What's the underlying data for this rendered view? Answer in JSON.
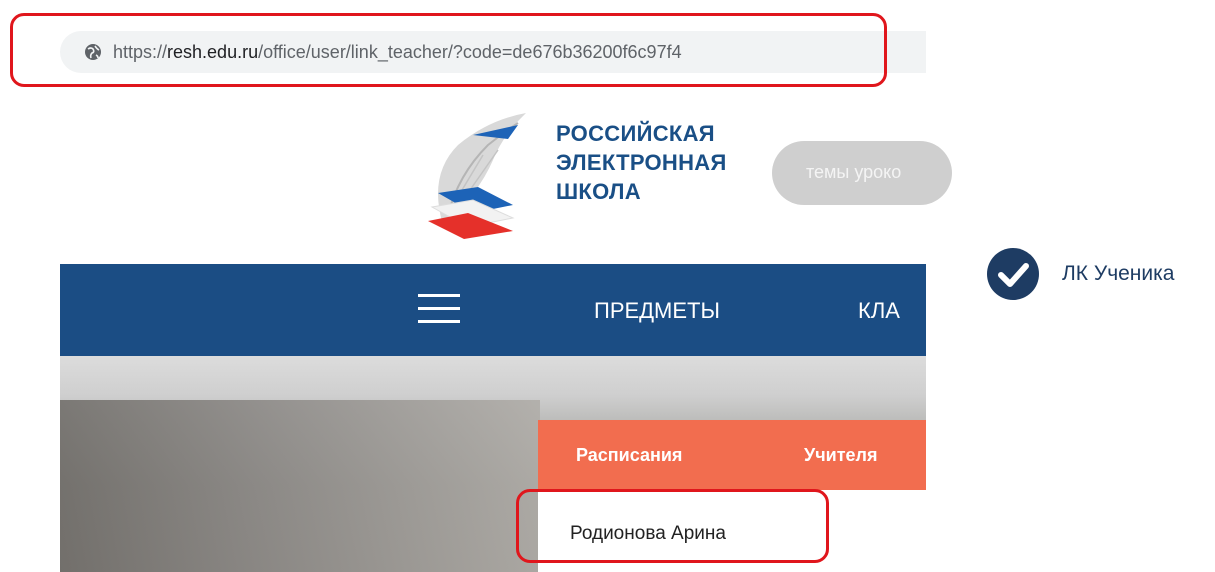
{
  "browser": {
    "url_prefix": "https://",
    "url_domain": "resh.edu.ru",
    "url_path": "/office/user/link_teacher/?code=de676b36200f6c97f4"
  },
  "site": {
    "logo_lines": [
      "РОССИЙСКАЯ",
      "ЭЛЕКТРОННАЯ",
      "ШКОЛА"
    ],
    "search_placeholder": "темы уроко"
  },
  "nav": {
    "items": [
      "ПРЕДМЕТЫ",
      "КЛА"
    ]
  },
  "tabs": [
    "Расписания",
    "Учителя"
  ],
  "dropdown": {
    "student_name": "Родионова Арина"
  },
  "annotation": {
    "label": "ЛК Ученика"
  },
  "colors": {
    "nav_bg": "#1b4d84",
    "tabs_bg": "#f26d4f",
    "highlight": "#e0161c",
    "badge": "#1e3c63"
  }
}
